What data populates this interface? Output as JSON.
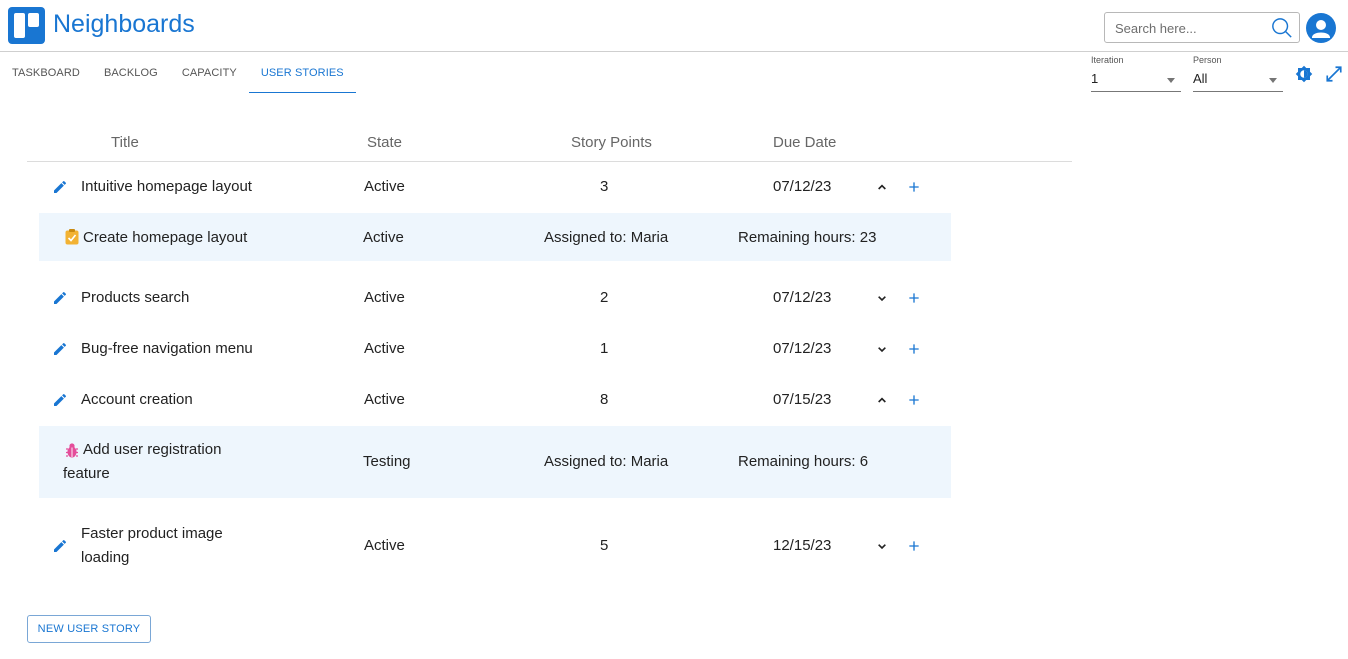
{
  "app": {
    "title": "Neighboards",
    "brand_color": "#1976d2"
  },
  "search": {
    "placeholder": "Search here..."
  },
  "tabs": [
    {
      "label": "TASKBOARD",
      "active": false
    },
    {
      "label": "BACKLOG",
      "active": false
    },
    {
      "label": "CAPACITY",
      "active": false
    },
    {
      "label": "USER STORIES",
      "active": true
    }
  ],
  "filters": {
    "iteration": {
      "label": "Iteration",
      "value": "1"
    },
    "person": {
      "label": "Person",
      "value": "All"
    }
  },
  "table": {
    "headers": {
      "title": "Title",
      "state": "State",
      "points": "Story Points",
      "due": "Due Date"
    },
    "stories": [
      {
        "title": "Intuitive homepage layout",
        "state": "Active",
        "points": "3",
        "due": "07/12/23",
        "expanded": true
      },
      {
        "title": "Products search",
        "state": "Active",
        "points": "2",
        "due": "07/12/23",
        "expanded": false
      },
      {
        "title": "Bug-free navigation menu",
        "state": "Active",
        "points": "1",
        "due": "07/12/23",
        "expanded": false
      },
      {
        "title": "Account creation",
        "state": "Active",
        "points": "8",
        "due": "07/15/23",
        "expanded": true
      },
      {
        "title_line1": "Faster product image",
        "title_line2": "loading",
        "state": "Active",
        "points": "5",
        "due": "12/15/23",
        "expanded": false
      }
    ],
    "tasks": [
      {
        "icon": "task-clipboard-icon",
        "title": "Create homepage layout",
        "state": "Active",
        "assigned": "Assigned to: Maria",
        "remaining": "Remaining hours: 23",
        "color": "#f2b233"
      },
      {
        "icon": "bug-icon",
        "title_line1": "Add user registration",
        "title_line2": "feature",
        "state": "Testing",
        "assigned": "Assigned to: Maria",
        "remaining": "Remaining hours: 6",
        "color": "#e44d9a"
      }
    ]
  },
  "actions": {
    "new_story": "NEW USER STORY"
  }
}
